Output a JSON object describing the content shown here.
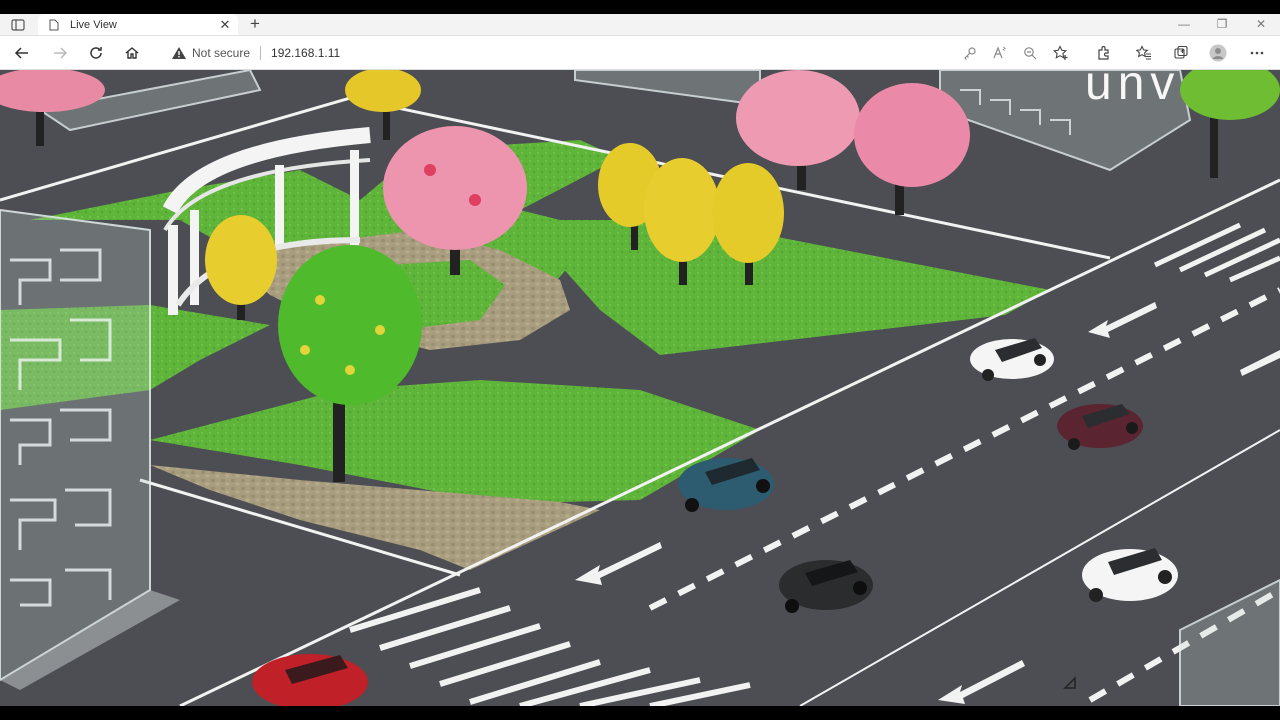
{
  "browser": {
    "tab": {
      "title": "Live View"
    },
    "address": {
      "security_label": "Not secure",
      "url": "192.168.1.11"
    }
  },
  "feed": {
    "watermark": "unv",
    "colors": {
      "road": "#4c4e53",
      "grass": "#5fb43a",
      "cobble": "#a89d7e",
      "markings": "#f2f2f2"
    }
  }
}
